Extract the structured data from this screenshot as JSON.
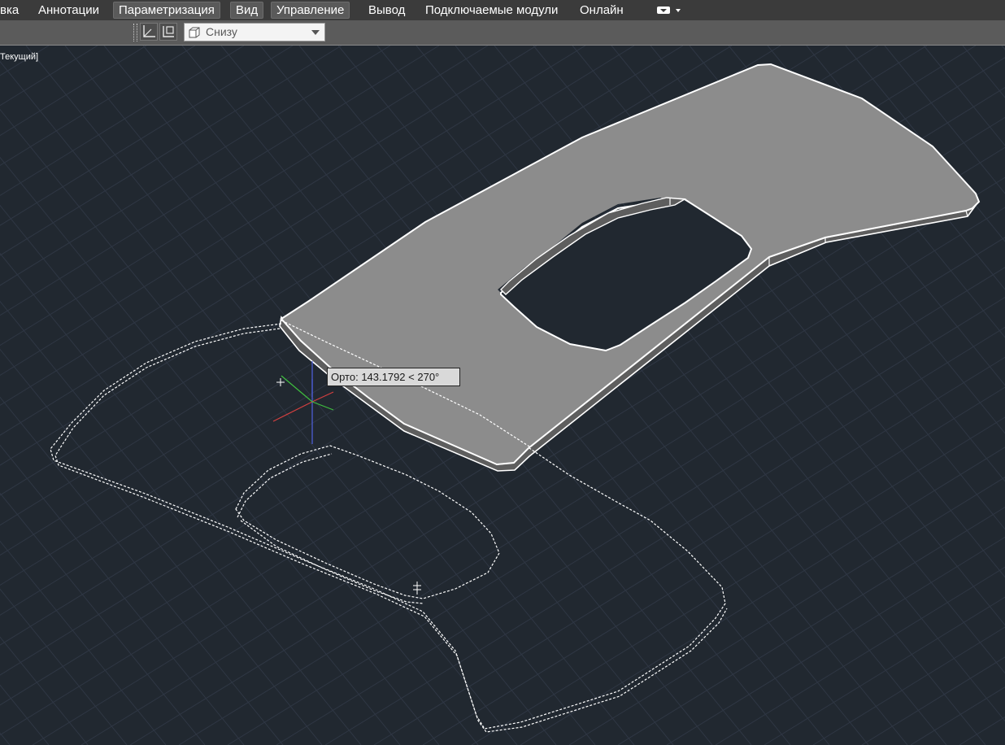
{
  "ribbon": {
    "tabs": [
      {
        "label": "вка",
        "active": false
      },
      {
        "label": "Аннотации",
        "active": false
      },
      {
        "label": "Параметризация",
        "active": true
      },
      {
        "label": "Вид",
        "active": true
      },
      {
        "label": "Управление",
        "active": true
      },
      {
        "label": "Вывод",
        "active": false
      },
      {
        "label": "Подключаемые модули",
        "active": false
      },
      {
        "label": "Онлайн",
        "active": false
      }
    ],
    "expand_icon": "ribbon-state-icon"
  },
  "toolbar": {
    "buttons": [
      {
        "icon": "ucs-icon"
      },
      {
        "icon": "ucs-view-icon"
      }
    ],
    "view_select": {
      "value": "Снизу",
      "icon": "view-cube-icon"
    }
  },
  "viewport": {
    "label": "Текущий]",
    "tooltip": "Орто: 143.1792 < 270°",
    "colors": {
      "background": "#212830",
      "grid": "#2f3744",
      "solid_top": "#8c8c8c",
      "solid_edge": "#ffffff",
      "axis_x": "#d44040",
      "axis_y": "#3fbf3f",
      "axis_z": "#5060e0"
    }
  }
}
